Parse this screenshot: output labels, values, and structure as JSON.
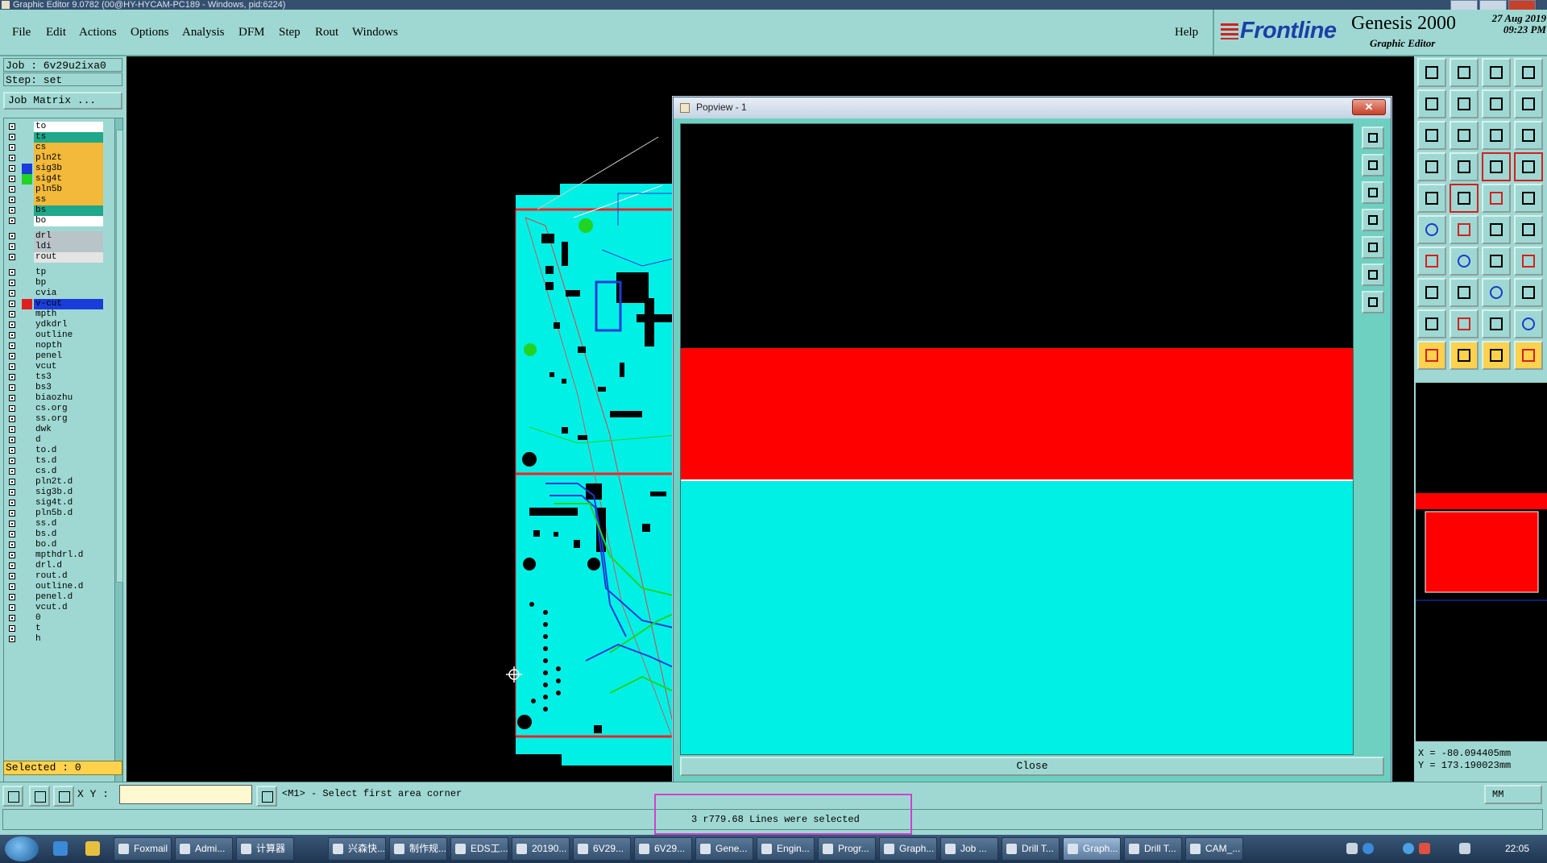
{
  "window": {
    "title": "Graphic Editor 9.0782 (00@HY-HYCAM-PC189 - Windows, pid:6224)"
  },
  "menu": [
    {
      "label": "File"
    },
    {
      "label": "Edit"
    },
    {
      "label": "Actions"
    },
    {
      "label": "Options"
    },
    {
      "label": "Analysis"
    },
    {
      "label": "DFM"
    },
    {
      "label": "Step"
    },
    {
      "label": "Rout"
    },
    {
      "label": "Windows"
    }
  ],
  "help_label": "Help",
  "brand": {
    "logo": "Frontline",
    "product": "Genesis 2000",
    "subtitle": "Graphic Editor",
    "date": "27 Aug 2019",
    "time": "09:23 PM"
  },
  "job": {
    "job_line": "Job : 6v29u2ixa0",
    "step_line": "Step: set",
    "matrix_button": "Job Matrix ..."
  },
  "layers": [
    {
      "name": "to",
      "color": "#ffffff",
      "swatch": ""
    },
    {
      "name": "ts",
      "color": "#1fa88a",
      "swatch": ""
    },
    {
      "name": "cs",
      "color": "#f2b93a",
      "swatch": ""
    },
    {
      "name": "pln2t",
      "color": "#f2b93a",
      "swatch": ""
    },
    {
      "name": "sig3b",
      "color": "#f2b93a",
      "swatch": "#1a3cd8"
    },
    {
      "name": "sig4t",
      "color": "#f2b93a",
      "swatch": "#22d422"
    },
    {
      "name": "pln5b",
      "color": "#f2b93a",
      "swatch": ""
    },
    {
      "name": "ss",
      "color": "#f2b93a",
      "swatch": ""
    },
    {
      "name": "bs",
      "color": "#1fa88a",
      "swatch": ""
    },
    {
      "name": "bo",
      "color": "#ffffff",
      "swatch": ""
    },
    {
      "name": "drl",
      "color": "#b8c4c8",
      "swatch": ""
    },
    {
      "name": "ldi",
      "color": "#b8c4c8",
      "swatch": ""
    },
    {
      "name": "rout",
      "color": "#e4e4e4",
      "swatch": ""
    },
    {
      "name": "tp",
      "color": "#9fd8d3",
      "swatch": ""
    },
    {
      "name": "bp",
      "color": "#9fd8d3",
      "swatch": ""
    },
    {
      "name": "cvia",
      "color": "#9fd8d3",
      "swatch": ""
    },
    {
      "name": "v-cut",
      "color": "#1a3cd8",
      "swatch": "#e02020"
    },
    {
      "name": "mpth",
      "color": "#9fd8d3",
      "swatch": ""
    },
    {
      "name": "ydkdrl",
      "color": "#9fd8d3",
      "swatch": ""
    },
    {
      "name": "outline",
      "color": "#9fd8d3",
      "swatch": ""
    },
    {
      "name": "nopth",
      "color": "#9fd8d3",
      "swatch": ""
    },
    {
      "name": "penel",
      "color": "#9fd8d3",
      "swatch": ""
    },
    {
      "name": "vcut",
      "color": "#9fd8d3",
      "swatch": ""
    },
    {
      "name": "ts3",
      "color": "#9fd8d3",
      "swatch": ""
    },
    {
      "name": "bs3",
      "color": "#9fd8d3",
      "swatch": ""
    },
    {
      "name": "biaozhu",
      "color": "#9fd8d3",
      "swatch": ""
    },
    {
      "name": "cs.org",
      "color": "#9fd8d3",
      "swatch": ""
    },
    {
      "name": "ss.org",
      "color": "#9fd8d3",
      "swatch": ""
    },
    {
      "name": "dwk",
      "color": "#9fd8d3",
      "swatch": ""
    },
    {
      "name": "d",
      "color": "#9fd8d3",
      "swatch": ""
    },
    {
      "name": "to.d",
      "color": "#9fd8d3",
      "swatch": ""
    },
    {
      "name": "ts.d",
      "color": "#9fd8d3",
      "swatch": ""
    },
    {
      "name": "cs.d",
      "color": "#9fd8d3",
      "swatch": ""
    },
    {
      "name": "pln2t.d",
      "color": "#9fd8d3",
      "swatch": ""
    },
    {
      "name": "sig3b.d",
      "color": "#9fd8d3",
      "swatch": ""
    },
    {
      "name": "sig4t.d",
      "color": "#9fd8d3",
      "swatch": ""
    },
    {
      "name": "pln5b.d",
      "color": "#9fd8d3",
      "swatch": ""
    },
    {
      "name": "ss.d",
      "color": "#9fd8d3",
      "swatch": ""
    },
    {
      "name": "bs.d",
      "color": "#9fd8d3",
      "swatch": ""
    },
    {
      "name": "bo.d",
      "color": "#9fd8d3",
      "swatch": ""
    },
    {
      "name": "mpthdrl.d",
      "color": "#9fd8d3",
      "swatch": ""
    },
    {
      "name": "drl.d",
      "color": "#9fd8d3",
      "swatch": ""
    },
    {
      "name": "rout.d",
      "color": "#9fd8d3",
      "swatch": ""
    },
    {
      "name": "outline.d",
      "color": "#9fd8d3",
      "swatch": ""
    },
    {
      "name": "penel.d",
      "color": "#9fd8d3",
      "swatch": ""
    },
    {
      "name": "vcut.d",
      "color": "#9fd8d3",
      "swatch": ""
    },
    {
      "name": "0",
      "color": "#9fd8d3",
      "swatch": ""
    },
    {
      "name": "t",
      "color": "#9fd8d3",
      "swatch": ""
    },
    {
      "name": "h",
      "color": "#9fd8d3",
      "swatch": ""
    }
  ],
  "selected_label": "Selected : 0",
  "popview": {
    "title": "Popview - 1",
    "close_label": "Close",
    "close_x": "✕"
  },
  "coords": {
    "x": "X = -80.094405mm",
    "y": "Y = 173.190023mm"
  },
  "command": {
    "xy_label": "X Y :",
    "xy_value": "",
    "prompt": "<M1> - Select first area corner",
    "units": "MM"
  },
  "status": {
    "message": "3 r779.68 Lines were selected"
  },
  "taskbar": {
    "tasks": [
      {
        "label": "Foxmail"
      },
      {
        "label": "Admi..."
      },
      {
        "label": "计算器"
      },
      {
        "label": "兴森快..."
      },
      {
        "label": "制作规..."
      },
      {
        "label": "EDS工..."
      },
      {
        "label": "20190..."
      },
      {
        "label": "6V29..."
      },
      {
        "label": "6V29..."
      },
      {
        "label": "Gene..."
      },
      {
        "label": "Engin..."
      },
      {
        "label": "Progr..."
      },
      {
        "label": "Graph..."
      },
      {
        "label": "Job ..."
      },
      {
        "label": "Drill T..."
      },
      {
        "label": "Graph..."
      },
      {
        "label": "Drill T..."
      },
      {
        "label": "CAM_..."
      }
    ],
    "clock": "22:05"
  },
  "colors": {
    "panel": "#9fd8d3",
    "board": "#00f0e6",
    "highlight": "#ff0000",
    "status_highlight": "#d040d0"
  }
}
